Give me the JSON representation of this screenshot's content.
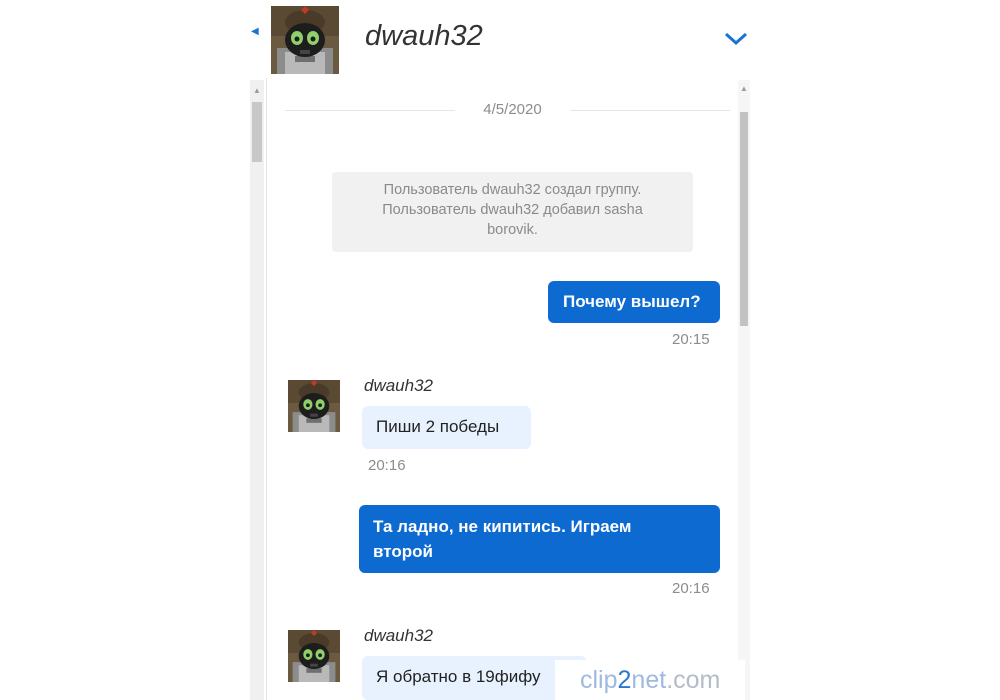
{
  "header": {
    "title": "dwauh32",
    "avatar_icon": "robot-avatar-icon",
    "chevron_icon": "chevron-down-icon"
  },
  "conversation": {
    "date_divider": "4/5/2020",
    "system_lines": [
      "Пользователь dwauh32 создал группу.",
      "Пользователь dwauh32 добавил sasha",
      "borovik."
    ],
    "messages": [
      {
        "direction": "outgoing",
        "text": "Почему вышел?",
        "time": "20:15"
      },
      {
        "direction": "incoming",
        "sender": "dwauh32",
        "text": "Пиши 2 победы",
        "time": "20:16"
      },
      {
        "direction": "outgoing",
        "text_lines": [
          "Та ладно, не кипитись. Играем",
          "второй"
        ],
        "time": "20:16"
      },
      {
        "direction": "incoming",
        "sender": "dwauh32",
        "text": "Я обратно в 19фифу"
      }
    ]
  },
  "watermark": {
    "part1": "clip",
    "part2": "2",
    "part3": "net",
    "part4": ".com"
  },
  "colors": {
    "accent": "#0d6ad1",
    "incoming_bg": "#e8f2ff",
    "system_bg": "#f1f1f1"
  }
}
